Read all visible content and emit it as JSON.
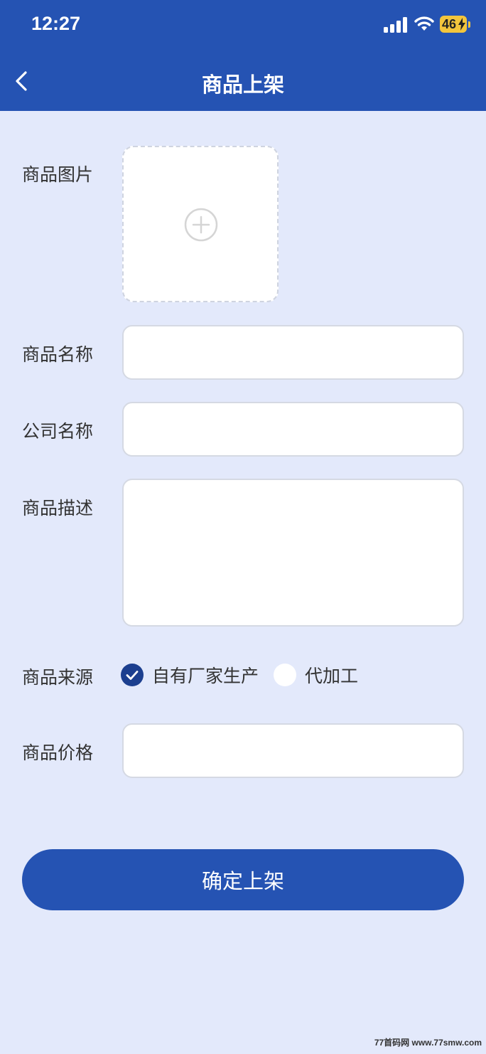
{
  "status_bar": {
    "time": "12:27",
    "battery": "46"
  },
  "nav": {
    "title": "商品上架"
  },
  "form": {
    "image_label": "商品图片",
    "name_label": "商品名称",
    "name_value": "",
    "company_label": "公司名称",
    "company_value": "",
    "desc_label": "商品描述",
    "desc_value": "",
    "source_label": "商品来源",
    "source_options": [
      {
        "label": "自有厂家生产",
        "checked": true
      },
      {
        "label": "代加工",
        "checked": false
      }
    ],
    "price_label": "商品价格",
    "price_value": ""
  },
  "submit_label": "确定上架",
  "watermark": "77首码网 www.77smw.com",
  "colors": {
    "primary": "#2553b3",
    "background": "#e3e9fb",
    "checked": "#1c3f8f"
  }
}
